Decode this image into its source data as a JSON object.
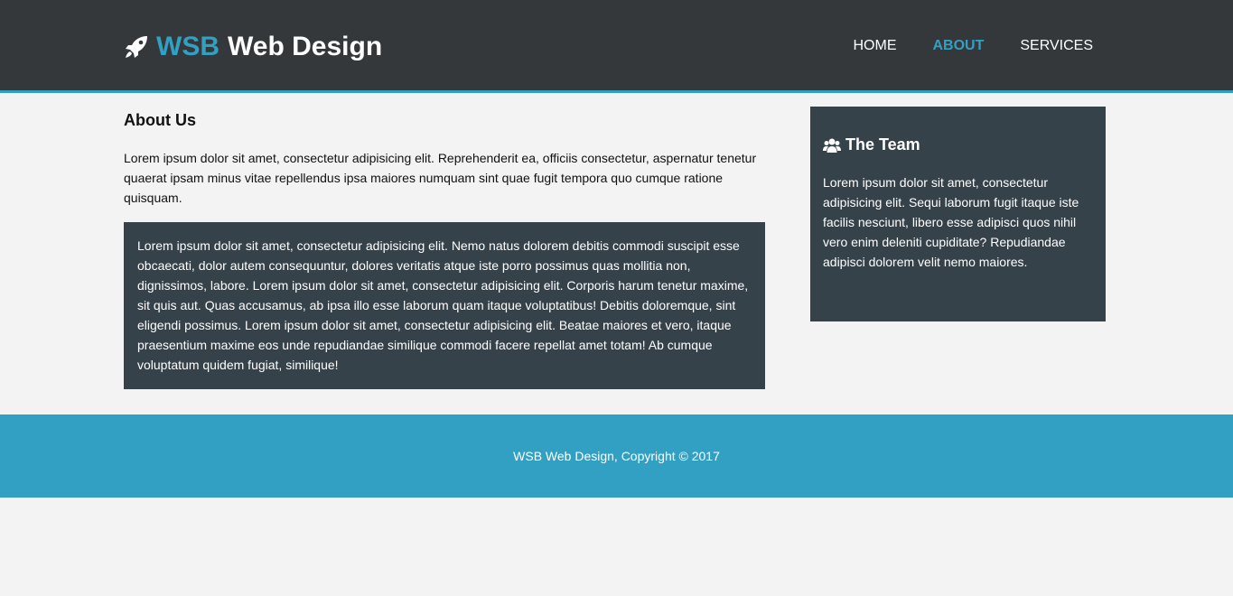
{
  "header": {
    "brand_highlight": "WSB",
    "brand_rest": "Web Design",
    "brand_icon": "rocket-icon",
    "nav": [
      "HOME",
      "ABOUT",
      "SERVICES"
    ],
    "active_nav": "ABOUT"
  },
  "main": {
    "title": "About Us",
    "intro": "Lorem ipsum dolor sit amet, consectetur adipisicing elit. Reprehenderit ea, officiis consectetur, aspernatur tenetur quaerat ipsam minus vitae repellendus ipsa maiores numquam sint quae fugit tempora quo cumque ratione quisquam.",
    "box_text": "Lorem ipsum dolor sit amet, consectetur adipisicing elit. Nemo natus dolorem debitis commodi suscipit esse obcaecati, dolor autem consequuntur, dolores veritatis atque iste porro possimus quas mollitia non, dignissimos, labore. Lorem ipsum dolor sit amet, consectetur adipisicing elit. Corporis harum tenetur maxime, sit quis aut. Quas accusamus, ab ipsa illo esse laborum quam itaque voluptatibus! Debitis doloremque, sint eligendi possimus. Lorem ipsum dolor sit amet, consectetur adipisicing elit. Beatae maiores et vero, itaque praesentium maxime eos unde repudiandae similique commodi facere repellat amet totam! Ab cumque voluptatum quidem fugiat, similique!"
  },
  "sidebar": {
    "title": "The Team",
    "icon": "users-icon",
    "text": "Lorem ipsum dolor sit amet, consectetur adipisicing elit. Sequi laborum fugit itaque iste facilis nesciunt, libero esse adipisci quos nihil vero enim deleniti cupiditate? Repudiandae adipisci dolorem velit nemo maiores."
  },
  "footer": {
    "text": "WSB Web Design, Copyright © 2017"
  },
  "colors": {
    "accent": "#32a0c3",
    "header_bg": "#35383b",
    "box_bg": "#35424a",
    "page_bg": "#f3f3f3"
  }
}
